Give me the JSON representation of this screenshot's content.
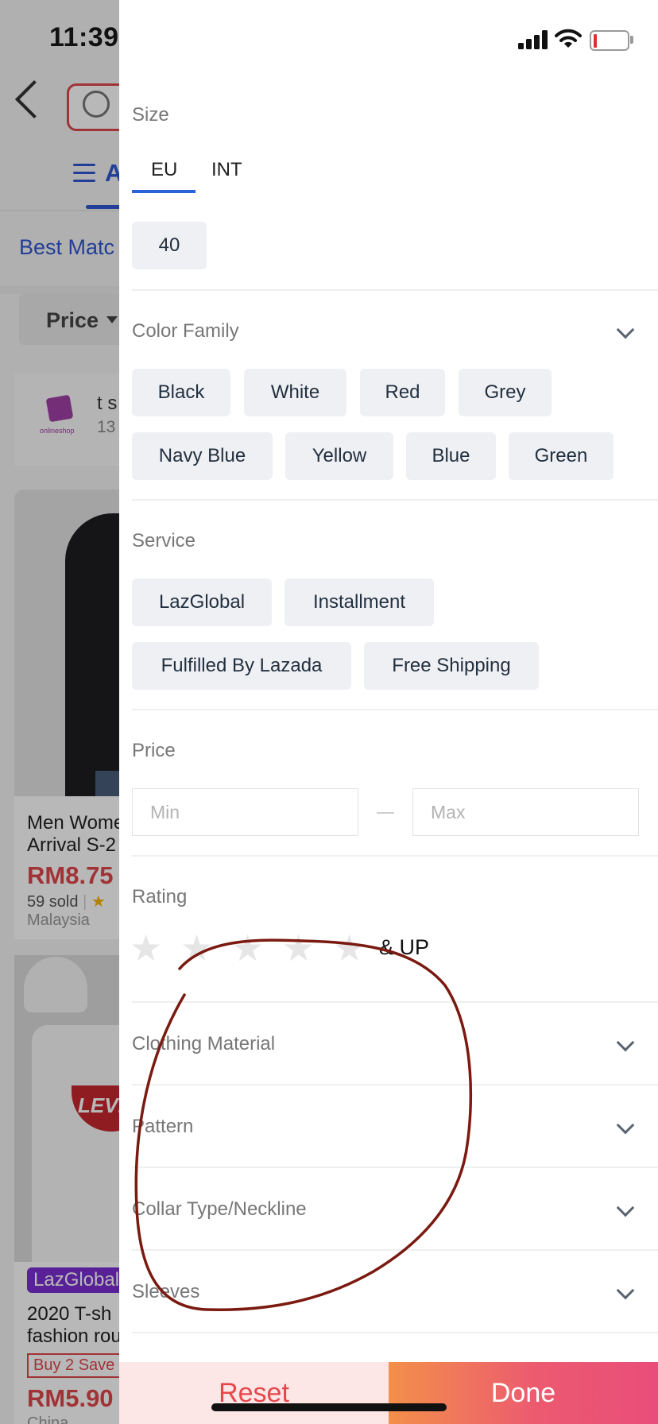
{
  "status_bar": {
    "time": "11:39",
    "icons": [
      "cellular-signal-icon",
      "wifi-icon",
      "battery-icon"
    ]
  },
  "background_page": {
    "tab_partial": "A",
    "sort_label": "Best Matc",
    "price_chip": "Price",
    "shop": {
      "logo_text": "onlineshop",
      "name": "t s",
      "count": "13"
    },
    "product_1": {
      "title_line1": "Men Wome",
      "title_line2": "Arrival S-2",
      "price": "RM8.75",
      "sold": "59 sold",
      "origin": "Malaysia"
    },
    "product_2": {
      "badge": "LazGlobal",
      "logo_text": "LEVI",
      "title_line1": "2020 T-sh",
      "title_line2": "fashion rou",
      "promo": "Buy 2 Save",
      "price": "RM5.90",
      "origin": "China"
    }
  },
  "filter": {
    "size": {
      "label": "Size",
      "tabs": [
        {
          "label": "EU",
          "active": true
        },
        {
          "label": "INT",
          "active": false
        }
      ],
      "options": [
        "40"
      ]
    },
    "color_family": {
      "label": "Color Family",
      "options": [
        "Black",
        "White",
        "Red",
        "Grey",
        "Navy Blue",
        "Yellow",
        "Blue",
        "Green"
      ]
    },
    "service": {
      "label": "Service",
      "options": [
        "LazGlobal",
        "Installment",
        "Fulfilled By Lazada",
        "Free Shipping"
      ]
    },
    "price": {
      "label": "Price",
      "min_placeholder": "Min",
      "max_placeholder": "Max",
      "min_value": "",
      "max_value": ""
    },
    "rating": {
      "label": "Rating",
      "stars": 5,
      "selected": 0,
      "suffix": "& UP"
    },
    "collapsed_sections": [
      "Clothing Material",
      "Pattern",
      "Collar Type/Neckline",
      "Sleeves"
    ]
  },
  "actions": {
    "reset_label": "Reset",
    "done_label": "Done"
  },
  "colors": {
    "accent_blue": "#2a63d9",
    "reset_text": "#e8464b",
    "done_gradient_start": "#f3904a",
    "done_gradient_end": "#e94d7a",
    "annotation": "#7a1a10"
  }
}
